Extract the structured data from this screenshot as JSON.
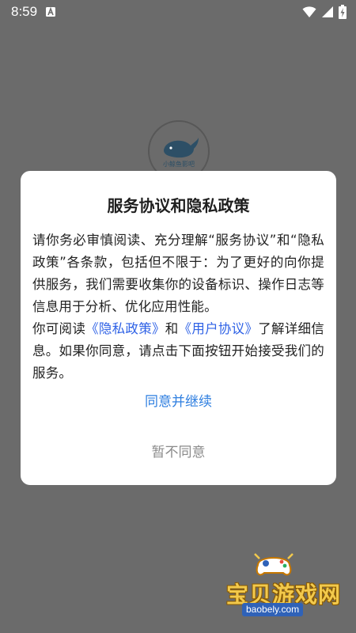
{
  "status_bar": {
    "time": "8:59",
    "notification_icon": "a-notification-icon",
    "wifi_icon": "wifi-icon",
    "signal_icon": "signal-icon",
    "battery_icon": "battery-charging-icon"
  },
  "splash": {
    "logo_icon": "whale-logo-icon",
    "logo_text": "小鲸鱼影吧"
  },
  "dialog": {
    "title": "服务协议和隐私政策",
    "paragraph1": "请你务必审慎阅读、充分理解“服务协议”和“隐私政策”各条款，包括但不限于：为了更好的向你提供服务，我们需要收集你的设备标识、操作日志等信息用于分析、优化应用性能。",
    "paragraph2_prefix": "你可阅读",
    "privacy_link": "《隐私政策》",
    "paragraph2_and": "和",
    "user_agreement_link": "《用户协议》",
    "paragraph2_suffix": "了解详细信息。如果你同意，请点击下面按钮开始接受我们的服务。",
    "agree_label": "同意并继续",
    "disagree_label": "暂不同意"
  },
  "watermark": {
    "title": "宝贝游戏网",
    "url": "baobely.com",
    "mascot_icon": "gamepad-mascot-icon"
  },
  "colors": {
    "overlay": "#6b6b6b",
    "link": "#2f62e6",
    "agree": "#2f7fe0",
    "disagree": "#8a8a8a"
  }
}
